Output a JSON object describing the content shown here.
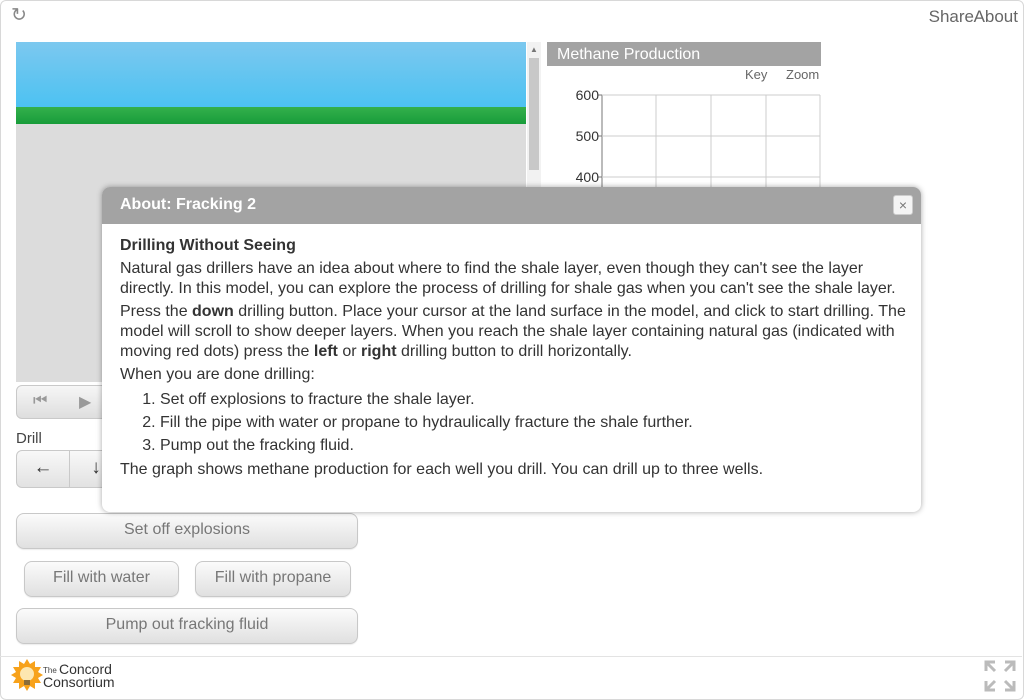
{
  "header": {
    "share_label": "Share",
    "about_label": "About",
    "reload_icon": "reload-icon"
  },
  "model": {
    "colors": {
      "sky": "#4cc2f2",
      "grass": "#1a9e3c",
      "ground": "#dcdcdc"
    }
  },
  "controls": {
    "drill_label": "Drill",
    "drill_left": "←",
    "drill_down": "↓",
    "explosions_label": "Set off explosions",
    "water_label": "Fill with water",
    "propane_label": "Fill with propane",
    "pump_label": "Pump out fracking fluid"
  },
  "graph": {
    "title": "Methane Production",
    "key_label": "Key",
    "zoom_label": "Zoom"
  },
  "chart_data": {
    "type": "line",
    "title": "Methane Production",
    "xlabel": "",
    "ylabel": "",
    "y_ticks_visible": [
      600,
      500,
      400
    ],
    "ylim": [
      0,
      600
    ],
    "grid": true,
    "series": []
  },
  "modal": {
    "title": "About: Fracking 2",
    "close_label": "×",
    "heading": "Drilling Without Seeing",
    "para1": "Natural gas drillers have an idea about where to find the shale layer, even though they can't see the layer directly. In this model, you can explore the process of drilling for shale gas when you can't see the shale layer.",
    "para2_a": "Press the ",
    "para2_b": "down",
    "para2_c": " drilling button. Place your cursor at the land surface in the model, and click to start drilling. The model will scroll to show deeper layers. When you reach the shale layer containing natural gas (indicated with moving red dots) press the ",
    "para2_d": "left",
    "para2_e": " or ",
    "para2_f": "right",
    "para2_g": " drilling button to drill horizontally.",
    "para3": "When you are done drilling:",
    "steps": [
      "Set off explosions to fracture the shale layer.",
      "Fill the pipe with water or propane to hydraulically fracture the shale further.",
      "Pump out the fracking fluid."
    ],
    "para4": "The graph shows methane production for each well you drill. You can drill up to three wells."
  },
  "footer": {
    "logo_the": "The",
    "logo_concord": "Concord",
    "logo_consortium": "Consortium"
  }
}
